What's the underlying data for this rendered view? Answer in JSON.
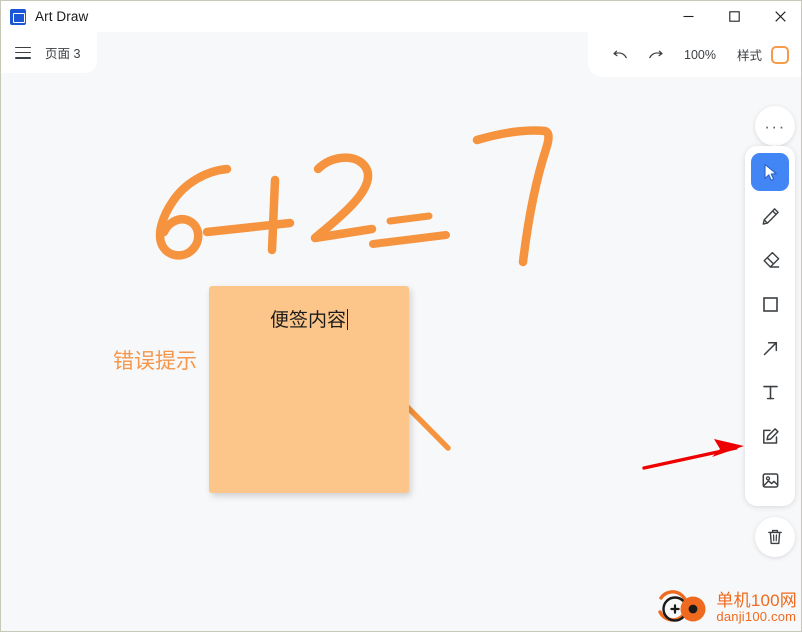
{
  "window": {
    "app_title": "Art Draw",
    "app_icon": "image-app-icon",
    "minimize_label": "minimize-icon",
    "maximize_label": "maximize-icon",
    "close_label": "close-icon"
  },
  "tab": {
    "menu_icon": "hamburger-menu-icon",
    "label": "页面 3"
  },
  "header": {
    "undo_icon": "undo-arrow-icon",
    "redo_icon": "redo-arrow-icon",
    "zoom_level": "100%",
    "style_label": "样式",
    "style_swatch_color": "#f59b4a"
  },
  "canvas": {
    "background_color": "#f7f8fa",
    "ink_color": "#f5933e",
    "handwriting": "6+2=7",
    "error_text": "错误提示",
    "note": {
      "text": "便签内容",
      "fill_color": "#fcc68b",
      "text_color": "#1c1c1c"
    },
    "annotation_arrow_color": "#ee0000"
  },
  "toolbar": {
    "more_label": "···",
    "tools": [
      {
        "name": "select-tool",
        "icon": "cursor-arrow-icon",
        "active": true
      },
      {
        "name": "pencil-tool",
        "icon": "pencil-icon",
        "active": false
      },
      {
        "name": "eraser-tool",
        "icon": "eraser-icon",
        "active": false
      },
      {
        "name": "rectangle-tool",
        "icon": "square-icon",
        "active": false
      },
      {
        "name": "arrow-tool",
        "icon": "arrow-up-right-icon",
        "active": false
      },
      {
        "name": "text-tool",
        "icon": "text-t-icon",
        "active": false
      },
      {
        "name": "note-tool",
        "icon": "note-pencil-icon",
        "active": false
      },
      {
        "name": "image-tool",
        "icon": "image-icon",
        "active": false
      }
    ],
    "delete_icon": "trash-icon"
  },
  "watermark": {
    "cn": "单机100网",
    "en": "danji100.com",
    "color": "#ef6a1e"
  }
}
